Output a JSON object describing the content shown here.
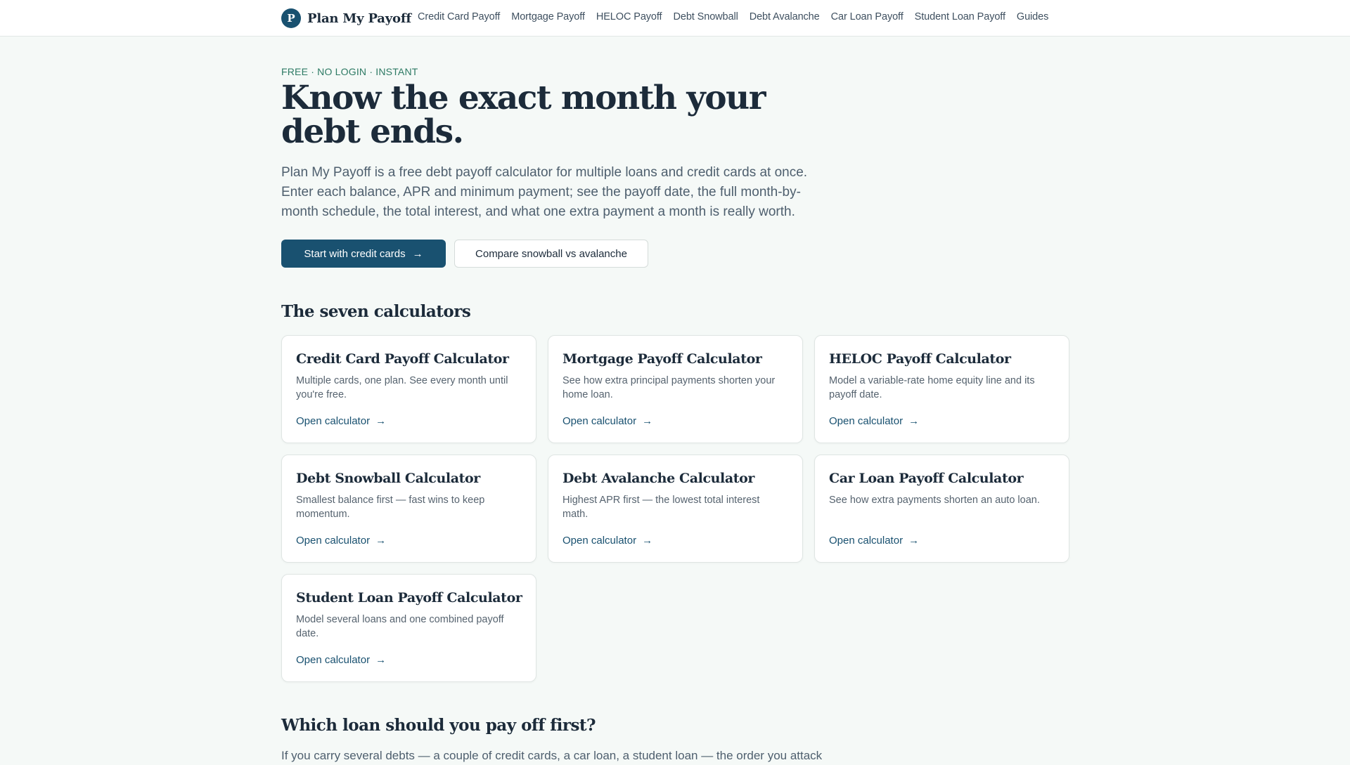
{
  "brand": {
    "mark": "P",
    "name": "Plan My Payoff"
  },
  "nav": [
    {
      "label": "Credit Card Payoff"
    },
    {
      "label": "Mortgage Payoff"
    },
    {
      "label": "HELOC Payoff"
    },
    {
      "label": "Debt Snowball"
    },
    {
      "label": "Debt Avalanche"
    },
    {
      "label": "Car Loan Payoff"
    },
    {
      "label": "Student Loan Payoff"
    },
    {
      "label": "Guides"
    }
  ],
  "hero": {
    "eyebrow": "FREE · NO LOGIN · INSTANT",
    "title": "Know the exact month your debt ends.",
    "subtitle": "Plan My Payoff is a free debt payoff calculator for multiple loans and credit cards at once. Enter each balance, APR and minimum payment; see the payoff date, the full month-by-month schedule, the total interest, and what one extra payment a month is really worth.",
    "primary_button": "Start with credit cards",
    "secondary_button": "Compare snowball vs avalanche",
    "arrow": "→"
  },
  "calculators": {
    "heading": "The seven calculators",
    "link_label": "Open calculator",
    "arrow": "→",
    "items": [
      {
        "title": "Credit Card Payoff Calculator",
        "desc": "Multiple cards, one plan. See every month until you're free."
      },
      {
        "title": "Mortgage Payoff Calculator",
        "desc": "See how extra principal payments shorten your home loan."
      },
      {
        "title": "HELOC Payoff Calculator",
        "desc": "Model a variable-rate home equity line and its payoff date."
      },
      {
        "title": "Debt Snowball Calculator",
        "desc": "Smallest balance first — fast wins to keep momentum."
      },
      {
        "title": "Debt Avalanche Calculator",
        "desc": "Highest APR first — the lowest total interest math."
      },
      {
        "title": "Car Loan Payoff Calculator",
        "desc": "See how extra payments shorten an auto loan."
      },
      {
        "title": "Student Loan Payoff Calculator",
        "desc": "Model several loans and one combined payoff date."
      }
    ]
  },
  "next_section": {
    "heading": "Which loan should you pay off first?",
    "text": "If you carry several debts — a couple of credit cards, a car loan, a student loan — the order you attack"
  },
  "colors": {
    "accent": "#195170",
    "eyebrow": "#2d7a64",
    "background": "#f5f9f7"
  }
}
